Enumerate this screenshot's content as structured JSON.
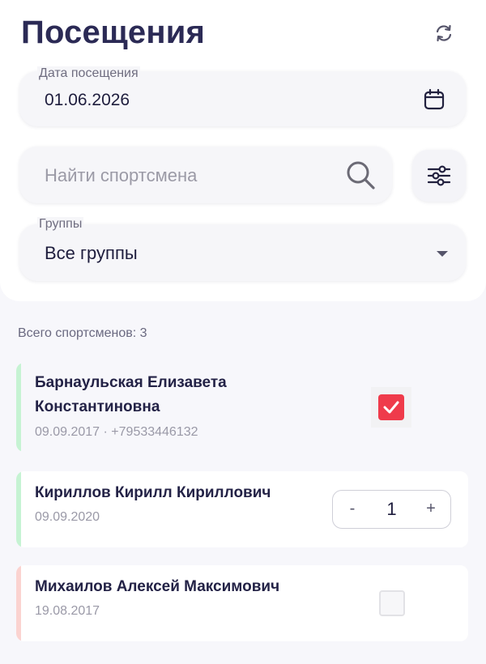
{
  "header": {
    "title": "Посещения"
  },
  "date_field": {
    "label": "Дата посещения",
    "value": "01.06.2026"
  },
  "search": {
    "placeholder": "Найти спортсмена",
    "value": ""
  },
  "groups_field": {
    "label": "Группы",
    "value": "Все группы"
  },
  "total_text": "Всего спортсменов: 3",
  "athletes": [
    {
      "name_line1": "Барнаульская Елизавета",
      "name_line2": "Константиновна",
      "details": "09.09.2017 · +79533446132",
      "stripe_color": "#c6f3d3",
      "control": "checkbox",
      "checked": true
    },
    {
      "name": "Кириллов Кирилл Кириллович",
      "details": "09.09.2020",
      "stripe_color": "#c6f3d3",
      "control": "stepper",
      "stepper": {
        "minus": "-",
        "value": "1",
        "plus": "+"
      }
    },
    {
      "name": "Михаилов Алексей Максимович",
      "details": "19.08.2017",
      "stripe_color": "#fbd3d0",
      "control": "checkbox",
      "checked": false
    }
  ],
  "colors": {
    "accent_red": "#ef3b4b",
    "title": "#2b2a55",
    "background": "#f7f7fb"
  },
  "icons": {
    "refresh": "refresh-icon",
    "calendar": "calendar-icon",
    "search": "search-icon",
    "filter": "sliders-icon",
    "dropdown": "caret-down-icon",
    "check": "check-icon"
  }
}
